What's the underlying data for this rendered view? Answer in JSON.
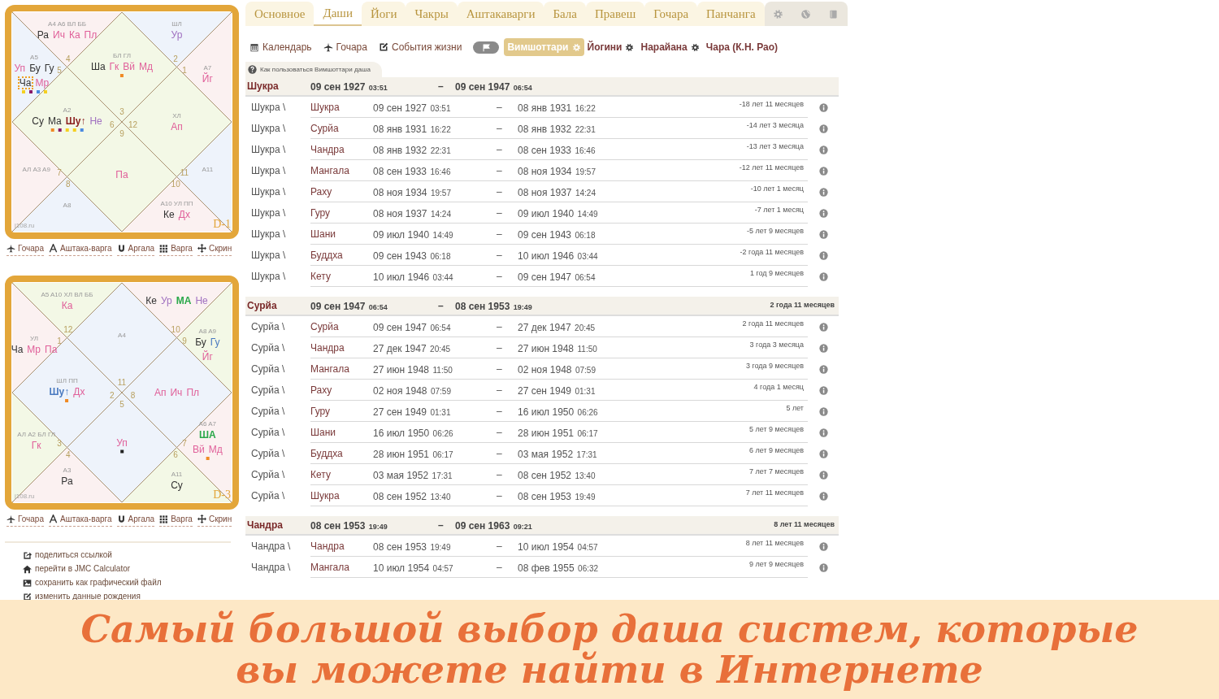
{
  "charts": [
    {
      "varga": "D-1",
      "site": "j108.ru",
      "houses": [
        {
          "sign": "3",
          "color": "#f3f8e6",
          "labels": "БЛ ГЛ",
          "planets": [
            {
              "text": "Ша",
              "color": "#333333"
            },
            {
              "text": "Гк",
              "color": "#e0609a"
            },
            {
              "text": "Вй",
              "color": "#e0609a"
            },
            {
              "text": "Мд",
              "color": "#e0609a"
            }
          ],
          "dots": [
            {
              "color": "#f08a24"
            }
          ]
        },
        {
          "sign": "4",
          "color": "#fbf1f1",
          "labels": "A4 A6 ВЛ ББ",
          "planets": [
            {
              "text": "Ра",
              "color": "#333333"
            },
            {
              "text": "Ич",
              "color": "#e0609a"
            },
            {
              "text": "Ка",
              "color": "#e0609a"
            },
            {
              "text": "Пл",
              "color": "#e0609a"
            }
          ]
        },
        {
          "sign": "5",
          "color": "#eef3fb",
          "labels": "A5",
          "planets": [
            {
              "text": "Уп",
              "color": "#e0609a"
            },
            {
              "text": "Бу",
              "color": "#333333"
            },
            {
              "text": "Гу",
              "color": "#333333"
            },
            {
              "text": "Ча",
              "color": "#333333",
              "boxed": true
            },
            {
              "text": "Мр",
              "color": "#e0609a"
            }
          ],
          "dots": [
            {
              "color": "#f5d020"
            },
            {
              "color": "#8a1a6a"
            },
            {
              "color": "#4a8ae0"
            },
            {
              "color": "#f5d020"
            }
          ]
        },
        {
          "sign": "6",
          "color": "#f3f8e6",
          "labels": "A2",
          "planets": [
            {
              "text": "Су",
              "color": "#333333"
            },
            {
              "text": "Ма",
              "color": "#333333"
            },
            {
              "text": "Шу↑",
              "color": "#8b2020",
              "bold": true
            },
            {
              "text": "Не",
              "color": "#a070c0"
            }
          ],
          "dots": [
            {
              "color": "#f08a24"
            },
            {
              "color": "#8a1a6a"
            },
            {
              "color": "#f5d020"
            },
            {
              "color": "#f5d020"
            },
            {
              "color": "#4a8ae0"
            }
          ]
        },
        {
          "sign": "7",
          "color": "#fbf1f1",
          "labels": "АЛ A3 A9"
        },
        {
          "sign": "8",
          "color": "#eef3fb",
          "labels": "A8"
        },
        {
          "sign": "9",
          "color": "#f3f8e6",
          "planets": [
            {
              "text": "Па",
              "color": "#e0609a"
            }
          ]
        },
        {
          "sign": "10",
          "color": "#fbf1f1",
          "labels": "A10 УЛ ПП",
          "planets": [
            {
              "text": "Ке",
              "color": "#333333"
            },
            {
              "text": "Дх",
              "color": "#e0609a"
            }
          ]
        },
        {
          "sign": "11",
          "color": "#eef3fb",
          "labels": "A11"
        },
        {
          "sign": "12",
          "color": "#f3f8e6",
          "labels": "ХЛ",
          "planets": [
            {
              "text": "Ап",
              "color": "#e0609a"
            }
          ]
        },
        {
          "sign": "1",
          "color": "#fbf1f1",
          "labels": "A7",
          "planets": [
            {
              "text": "Йг",
              "color": "#e0609a"
            }
          ]
        },
        {
          "sign": "2",
          "color": "#eef3fb",
          "labels": "ШЛ",
          "planets": [
            {
              "text": "Ур",
              "color": "#a070c0"
            }
          ]
        }
      ],
      "tools": [
        {
          "kind": "transit",
          "label": "Гочара"
        },
        {
          "kind": "ashtaka",
          "label": "Аштака-варга"
        },
        {
          "kind": "argala",
          "label": "Аргала"
        },
        {
          "kind": "varga",
          "label": "Варга"
        },
        {
          "kind": "screen",
          "label": "Скрин"
        }
      ]
    },
    {
      "varga": "D-3",
      "site": "j108.ru",
      "houses": [
        {
          "sign": "11",
          "color": "#eef3fb",
          "labels": "A4"
        },
        {
          "sign": "12",
          "color": "#f3f8e6",
          "labels": "A5 A10 ХЛ ВЛ ББ",
          "planets": [
            {
              "text": "Ка",
              "color": "#e0609a"
            }
          ]
        },
        {
          "sign": "1",
          "color": "#fbf1f1",
          "labels": "УЛ",
          "planets": [
            {
              "text": "Ча",
              "color": "#333333"
            },
            {
              "text": "Мр",
              "color": "#e0609a"
            },
            {
              "text": "Па",
              "color": "#e0609a"
            }
          ]
        },
        {
          "sign": "2",
          "color": "#eef3fb",
          "labels": "ШЛ ПП",
          "planets": [
            {
              "text": "Шу↑",
              "color": "#4a7ac0",
              "bold": true
            },
            {
              "text": "Дх",
              "color": "#e0609a"
            }
          ],
          "dots": [
            {
              "color": "#f08a24"
            }
          ]
        },
        {
          "sign": "3",
          "color": "#f3f8e6",
          "labels": "АЛ A2 БЛ ГЛ",
          "planets": [
            {
              "text": "Гк",
              "color": "#e0609a"
            }
          ]
        },
        {
          "sign": "4",
          "color": "#fbf1f1",
          "labels": "A3",
          "planets": [
            {
              "text": "Ра",
              "color": "#333333"
            }
          ]
        },
        {
          "sign": "5",
          "color": "#eef3fb",
          "planets": [
            {
              "text": "Уп",
              "color": "#e0609a"
            }
          ],
          "dots": [
            {
              "color": "#222222"
            }
          ]
        },
        {
          "sign": "6",
          "color": "#f3f8e6",
          "labels": "A11",
          "planets": [
            {
              "text": "Су",
              "color": "#333333"
            }
          ]
        },
        {
          "sign": "7",
          "color": "#fbf1f1",
          "labels": "A6 A7",
          "planets": [
            {
              "text": "ША",
              "color": "#2aa84a",
              "bold": true
            },
            {
              "text": "Вй",
              "color": "#e0609a"
            },
            {
              "text": "Мд",
              "color": "#e0609a"
            }
          ],
          "dots": [
            {
              "color": "#f08a24"
            }
          ]
        },
        {
          "sign": "8",
          "color": "#eef3fb",
          "planets": [
            {
              "text": "Ап",
              "color": "#e0609a"
            },
            {
              "text": "Ич",
              "color": "#e0609a"
            },
            {
              "text": "Пл",
              "color": "#e0609a"
            }
          ]
        },
        {
          "sign": "9",
          "color": "#f3f8e6",
          "labels": "A8 A9",
          "planets": [
            {
              "text": "Бу",
              "color": "#333333"
            },
            {
              "text": "Гу",
              "color": "#4a7ac0"
            },
            {
              "text": "Йг",
              "color": "#e0609a"
            }
          ]
        },
        {
          "sign": "10",
          "color": "#fbf1f1",
          "planets": [
            {
              "text": "Ке",
              "color": "#333333"
            },
            {
              "text": "Ур",
              "color": "#a070c0"
            },
            {
              "text": "МА",
              "color": "#2aa84a",
              "bold": true
            },
            {
              "text": "Не",
              "color": "#a070c0"
            }
          ]
        }
      ],
      "tools": [
        {
          "kind": "transit",
          "label": "Гочара"
        },
        {
          "kind": "ashtaka",
          "label": "Аштака-варга"
        },
        {
          "kind": "argala",
          "label": "Аргала"
        },
        {
          "kind": "varga",
          "label": "Варга"
        },
        {
          "kind": "screen",
          "label": "Скрин"
        }
      ]
    }
  ],
  "links": [
    {
      "kind": "share",
      "label": "поделиться ссылкой"
    },
    {
      "kind": "home",
      "label": "перейти в JMC Calculator"
    },
    {
      "kind": "image",
      "label": "сохранить как графический файл"
    },
    {
      "kind": "edit",
      "label": "изменить данные рождения"
    }
  ],
  "tabs": [
    {
      "label": "Основное",
      "selected": false
    },
    {
      "label": "Даши",
      "selected": true
    },
    {
      "label": "Йоги",
      "selected": false
    },
    {
      "label": "Чакры",
      "selected": false
    },
    {
      "label": "Аштакаварги",
      "selected": false
    },
    {
      "label": "Бала",
      "selected": false
    },
    {
      "label": "Правеш",
      "selected": false
    },
    {
      "label": "Гочара",
      "selected": false
    },
    {
      "label": "Панчанга",
      "selected": false
    }
  ],
  "tools": [
    {
      "kind": "calendar",
      "label": "Календарь"
    },
    {
      "kind": "transit",
      "label": "Гочара"
    },
    {
      "kind": "edit",
      "label": "События жизни"
    }
  ],
  "flag_toggle": {
    "on": false
  },
  "systems": [
    {
      "label": "Вимшоттари",
      "selected": true
    },
    {
      "label": "Йогини",
      "selected": false
    },
    {
      "label": "Нарайана",
      "selected": false
    },
    {
      "label": "Чара (К.Н. Рао)",
      "selected": false
    }
  ],
  "help_tab": "Как пользоваться Вимшоттари даша",
  "groups": [
    {
      "planet": "Шукра",
      "start": {
        "date": "09 сен 1927",
        "time": "03:51"
      },
      "dash": "–",
      "end": {
        "date": "09 сен 1947",
        "time": "06:54"
      },
      "rows": [
        {
          "parent": "Шукра \\",
          "planet": "Шукра",
          "start": {
            "date": "09 сен 1927",
            "time": "03:51"
          },
          "dash": "–",
          "end": {
            "date": "08 янв 1931",
            "time": "16:22"
          },
          "duration": "-18 лет 11 месяцев"
        },
        {
          "parent": "Шукра \\",
          "planet": "Сурйа",
          "start": {
            "date": "08 янв 1931",
            "time": "16:22"
          },
          "dash": "–",
          "end": {
            "date": "08 янв 1932",
            "time": "22:31"
          },
          "duration": "-14 лет 3 месяца"
        },
        {
          "parent": "Шукра \\",
          "planet": "Чандра",
          "start": {
            "date": "08 янв 1932",
            "time": "22:31"
          },
          "dash": "–",
          "end": {
            "date": "08 сен 1933",
            "time": "16:46"
          },
          "duration": "-13 лет 3 месяца"
        },
        {
          "parent": "Шукра \\",
          "planet": "Мангала",
          "start": {
            "date": "08 сен 1933",
            "time": "16:46"
          },
          "dash": "–",
          "end": {
            "date": "08 ноя 1934",
            "time": "19:57"
          },
          "duration": "-12 лет 11 месяцев"
        },
        {
          "parent": "Шукра \\",
          "planet": "Раху",
          "start": {
            "date": "08 ноя 1934",
            "time": "19:57"
          },
          "dash": "–",
          "end": {
            "date": "08 ноя 1937",
            "time": "14:24"
          },
          "duration": "-10 лет 1 месяц"
        },
        {
          "parent": "Шукра \\",
          "planet": "Гуру",
          "start": {
            "date": "08 ноя 1937",
            "time": "14:24"
          },
          "dash": "–",
          "end": {
            "date": "09 июл 1940",
            "time": "14:49"
          },
          "duration": "-7 лет 1 месяц"
        },
        {
          "parent": "Шукра \\",
          "planet": "Шани",
          "start": {
            "date": "09 июл 1940",
            "time": "14:49"
          },
          "dash": "–",
          "end": {
            "date": "09 сен 1943",
            "time": "06:18"
          },
          "duration": "-5 лет 9 месяцев"
        },
        {
          "parent": "Шукра \\",
          "planet": "Буддха",
          "start": {
            "date": "09 сен 1943",
            "time": "06:18"
          },
          "dash": "–",
          "end": {
            "date": "10 июл 1946",
            "time": "03:44"
          },
          "duration": "-2 года 11 месяцев"
        },
        {
          "parent": "Шукра \\",
          "planet": "Кету",
          "start": {
            "date": "10 июл 1946",
            "time": "03:44"
          },
          "dash": "–",
          "end": {
            "date": "09 сен 1947",
            "time": "06:54"
          },
          "duration": "1 год 9 месяцев"
        }
      ]
    },
    {
      "planet": "Сурйа",
      "start": {
        "date": "09 сен 1947",
        "time": "06:54"
      },
      "dash": "–",
      "end": {
        "date": "08 сен 1953",
        "time": "19:49"
      },
      "duration": "2 года 11 месяцев",
      "rows": [
        {
          "parent": "Сурйа \\",
          "planet": "Сурйа",
          "start": {
            "date": "09 сен 1947",
            "time": "06:54"
          },
          "dash": "–",
          "end": {
            "date": "27 дек 1947",
            "time": "20:45"
          },
          "duration": "2 года 11 месяцев"
        },
        {
          "parent": "Сурйа \\",
          "planet": "Чандра",
          "start": {
            "date": "27 дек 1947",
            "time": "20:45"
          },
          "dash": "–",
          "end": {
            "date": "27 июн 1948",
            "time": "11:50"
          },
          "duration": "3 года 3 месяца"
        },
        {
          "parent": "Сурйа \\",
          "planet": "Мангала",
          "start": {
            "date": "27 июн 1948",
            "time": "11:50"
          },
          "dash": "–",
          "end": {
            "date": "02 ноя 1948",
            "time": "07:59"
          },
          "duration": "3 года 9 месяцев"
        },
        {
          "parent": "Сурйа \\",
          "planet": "Раху",
          "start": {
            "date": "02 ноя 1948",
            "time": "07:59"
          },
          "dash": "–",
          "end": {
            "date": "27 сен 1949",
            "time": "01:31"
          },
          "duration": "4 года 1 месяц"
        },
        {
          "parent": "Сурйа \\",
          "planet": "Гуру",
          "start": {
            "date": "27 сен 1949",
            "time": "01:31"
          },
          "dash": "–",
          "end": {
            "date": "16 июл 1950",
            "time": "06:26"
          },
          "duration": "5 лет"
        },
        {
          "parent": "Сурйа \\",
          "planet": "Шани",
          "start": {
            "date": "16 июл 1950",
            "time": "06:26"
          },
          "dash": "–",
          "end": {
            "date": "28 июн 1951",
            "time": "06:17"
          },
          "duration": "5 лет 9 месяцев"
        },
        {
          "parent": "Сурйа \\",
          "planet": "Буддха",
          "start": {
            "date": "28 июн 1951",
            "time": "06:17"
          },
          "dash": "–",
          "end": {
            "date": "03 мая 1952",
            "time": "17:31"
          },
          "duration": "6 лет 9 месяцев"
        },
        {
          "parent": "Сурйа \\",
          "planet": "Кету",
          "start": {
            "date": "03 мая 1952",
            "time": "17:31"
          },
          "dash": "–",
          "end": {
            "date": "08 сен 1952",
            "time": "13:40"
          },
          "duration": "7 лет 7 месяцев"
        },
        {
          "parent": "Сурйа \\",
          "planet": "Шукра",
          "start": {
            "date": "08 сен 1952",
            "time": "13:40"
          },
          "dash": "–",
          "end": {
            "date": "08 сен 1953",
            "time": "19:49"
          },
          "duration": "7 лет 11 месяцев"
        }
      ]
    },
    {
      "planet": "Чандра",
      "start": {
        "date": "08 сен 1953",
        "time": "19:49"
      },
      "dash": "–",
      "end": {
        "date": "09 сен 1963",
        "time": "09:21"
      },
      "duration": "8 лет 11 месяцев",
      "rows": [
        {
          "parent": "Чандра \\",
          "planet": "Чандра",
          "start": {
            "date": "08 сен 1953",
            "time": "19:49"
          },
          "dash": "–",
          "end": {
            "date": "10 июл 1954",
            "time": "04:57"
          },
          "duration": "8 лет 11 месяцев"
        },
        {
          "parent": "Чандра \\",
          "planet": "Мангала",
          "start": {
            "date": "10 июл 1954",
            "time": "04:57"
          },
          "dash": "–",
          "end": {
            "date": "08 фев 1955",
            "time": "06:32"
          },
          "duration": "9 лет 9 месяцев"
        }
      ]
    }
  ],
  "banner": {
    "lines": [
      "Самый большой выбор даша систем, которые",
      "вы можете найти в Интернете"
    ]
  }
}
